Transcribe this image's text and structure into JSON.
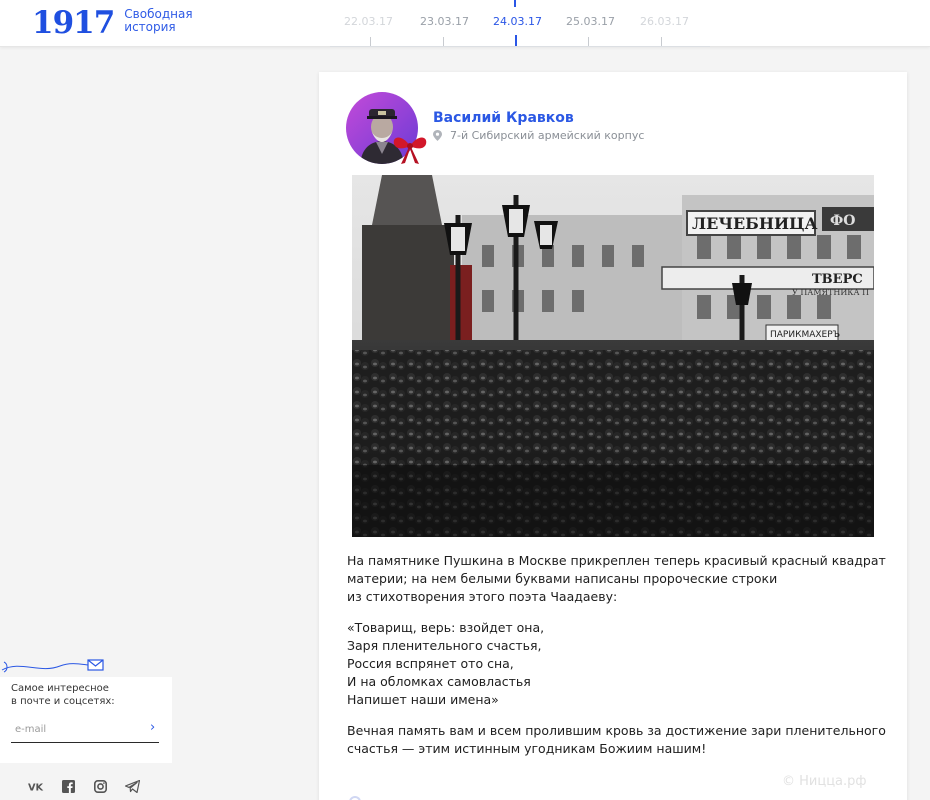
{
  "header": {
    "logo_number": "1917",
    "logo_text_line1": "Свободная",
    "logo_text_line2": "история"
  },
  "timeline": {
    "dates": [
      {
        "label": "22.03.17",
        "state": "faded"
      },
      {
        "label": "23.03.17",
        "state": "normal"
      },
      {
        "label": "24.03.17",
        "state": "active"
      },
      {
        "label": "25.03.17",
        "state": "normal"
      },
      {
        "label": "26.03.17",
        "state": "faded"
      }
    ]
  },
  "post": {
    "author_name": "Василий Кравков",
    "author_location": "7-й Сибирский армейский корпус",
    "location_icon": "pin-icon",
    "photo_signs": {
      "sign_left": "ЛЕЧЕБНИЦА",
      "sign_tver": "ТВЕРС",
      "sign_under": "У ПАМЯТНИКА П",
      "sign_barber": "ПАРИКМАХЕРЪ",
      "sign_fo": "ФО"
    },
    "paragraph1": "На памятнике Пушкина в Москве прикреплен теперь красивый красный квадрат материи; на нем белыми буквами написаны пророческие строки из стихотворения этого поэта Чаадаеву:",
    "paragraph1_lines": [
      "На памятнике Пушкина в Москве прикреплен теперь красивый красный квадрат",
      "материи; на нем белыми буквами написаны пророческие строки",
      "из стихотворения этого поэта Чаадаеву:"
    ],
    "poem_lines": [
      "«Товарищ, верь: взойдет она,",
      "Заря пленительного счастья,",
      "Россия вспрянет ото сна,",
      "И на обломках самовластья",
      "Напишет наши имена»"
    ],
    "paragraph3_lines": [
      "Вечная память вам и всем пролившим кровь за достижение зари пленительного",
      "счастья — этим истинным угодникам Божиим нашим!"
    ],
    "watermark": "© Ницца.рф"
  },
  "subscribe": {
    "text_line1": "Самое интересное",
    "text_line2": "в почте и соцсетях:",
    "email_placeholder": "e-mail",
    "submit_glyph": "›",
    "icon": "mail-plane-icon"
  },
  "social": {
    "vk_label": "VK",
    "items": [
      "vk-icon",
      "facebook-icon",
      "instagram-icon",
      "telegram-icon"
    ]
  },
  "colors": {
    "accent": "#2b58e4",
    "bow_red": "#d2172a",
    "background": "#f4f4f4"
  }
}
